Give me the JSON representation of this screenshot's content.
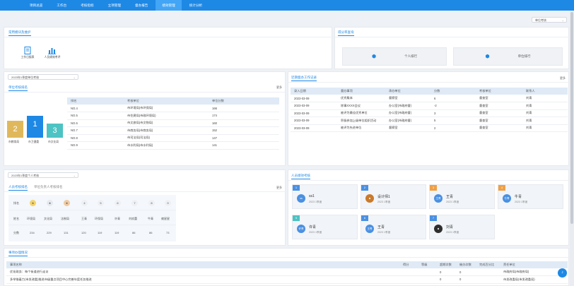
{
  "nav": [
    "项目总览",
    "工作台",
    "考核指标",
    "立项管理",
    "督办报告",
    "绩效管理",
    "统计分析"
  ],
  "nav_active": 5,
  "top_select": "单位考核",
  "common_panel": {
    "title": "常用模块及维护",
    "icons": [
      "工作日报表",
      "人员绩效考评"
    ]
  },
  "score_query": {
    "title": "得分率查询",
    "buttons": [
      "个人排行",
      "单位排行"
    ]
  },
  "unit_rank": {
    "select": "2023年1季度单位考核",
    "title": "单位考核排名",
    "more": "更多",
    "podium": [
      {
        "place": "2",
        "name": "市教育局",
        "color": "#e0b85c"
      },
      {
        "place": "1",
        "name": "市卫健委",
        "color": "#1e88e5"
      },
      {
        "place": "3",
        "name": "市文化局",
        "color": "#4dc3c3"
      }
    ],
    "columns": [
      "排名",
      "考核单位",
      "单位分数"
    ],
    "rows": [
      [
        "NO.4",
        "市环境局(市环保局)",
        "166"
      ],
      [
        "NO.5",
        "市住建局(市政环境局)",
        "174"
      ],
      [
        "NO.6",
        "市文旅局(市文物局)",
        "160"
      ],
      [
        "NO.7",
        "市商务局(市商务局)",
        "152"
      ],
      [
        "NO.8",
        "市司法局(司法局)",
        "147"
      ],
      [
        "NO.9",
        "市水利局(市水利局)",
        "141"
      ]
    ]
  },
  "recent_work": {
    "title": "近期督办工作记录",
    "more": "更多",
    "columns": [
      "录入日期",
      "督办事项",
      "承办单位",
      "分数",
      "考核单位",
      "联系人"
    ],
    "rows": [
      [
        "2023-03-09",
        "优秀集体",
        "督察室",
        "6",
        "督查室",
        "刘青"
      ],
      [
        "2023-03-09",
        "除事XXXX会议",
        "办公室(市政府督)",
        "-2",
        "督查室",
        "刘青"
      ],
      [
        "2023-03-09",
        "被评为最佳优秀单位",
        "办公室(市政府督)",
        "3",
        "督查室",
        "刘青"
      ],
      [
        "2023-03-09",
        "积极参加上级单位组织活动",
        "办公室(市政府督)",
        "5",
        "督查室",
        "刘青"
      ],
      [
        "2023-03-09",
        "被评为先进单位",
        "督察室",
        "2",
        "督查室",
        "刘青"
      ]
    ]
  },
  "person_rank": {
    "select": "2023年1季度个人考核",
    "tabs": [
      "人员考核排名",
      "单位负责人考核排名"
    ],
    "more": "更多",
    "rank_label": "排名",
    "ranks": [
      "1",
      "2",
      "3",
      "4",
      "5",
      "6",
      "7",
      "8",
      "9"
    ],
    "name_label": "姓名",
    "names": [
      "环境局",
      "文化局",
      "法制局",
      "王青",
      "环保局",
      "许青",
      "刘欢蕾",
      "牛青",
      "雍星星"
    ],
    "score_label": "分数",
    "scores": [
      "234",
      "229",
      "131",
      "120",
      "119",
      "119",
      "86",
      "86",
      "73"
    ]
  },
  "person_score": {
    "title": "人员绩效考核",
    "cards": [
      {
        "badge": "1",
        "avatar": "ss",
        "name": "ss1",
        "sub": "2023 1季度",
        "color": "#4a90e2",
        "avatar_color": "#4a90e2"
      },
      {
        "badge": "2",
        "avatar": "",
        "name": "设计师1",
        "sub": "2023 1季度",
        "color": "#4a90e2",
        "avatar_color": "#c97a2b"
      },
      {
        "badge": "3",
        "avatar": "王青",
        "name": "王青",
        "sub": "2023 1季度",
        "color": "#f0a043",
        "avatar_color": "#4a90e2"
      },
      {
        "badge": "4",
        "avatar": "牛青",
        "name": "牛青",
        "sub": "2023 1季度",
        "color": "#f0a043",
        "avatar_color": "#4a90e2"
      },
      {
        "badge": "5",
        "avatar": "许青",
        "name": "许青",
        "sub": "2023 1季度",
        "color": "#4dc3c3",
        "avatar_color": "#4a90e2"
      },
      {
        "badge": "6",
        "avatar": "王青",
        "name": "王青",
        "sub": "2023 1季度",
        "color": "#4a90e2",
        "avatar_color": "#4a90e2"
      },
      {
        "badge": "7",
        "avatar": "",
        "name": "刘青",
        "sub": "2023 1季度",
        "color": "#4a90e2",
        "avatar_color": "#2e2e2e"
      }
    ]
  },
  "todo": {
    "title": "事项办理情况",
    "columns": [
      "事项名称",
      "得分",
      "等级",
      "超期次数",
      "催办次数",
      "完成百分比",
      "责任单位"
    ],
    "rows": [
      [
        "优化政务：每个街道进行走访",
        "",
        "",
        "0",
        "0",
        "",
        "市政府局(市政府局)"
      ],
      [
        "多举措着力(市发改委)推进市级重点项目中心完善年度任务推进",
        "",
        "",
        "0",
        "0",
        "",
        "市发改委局(市发改委局)"
      ]
    ]
  }
}
